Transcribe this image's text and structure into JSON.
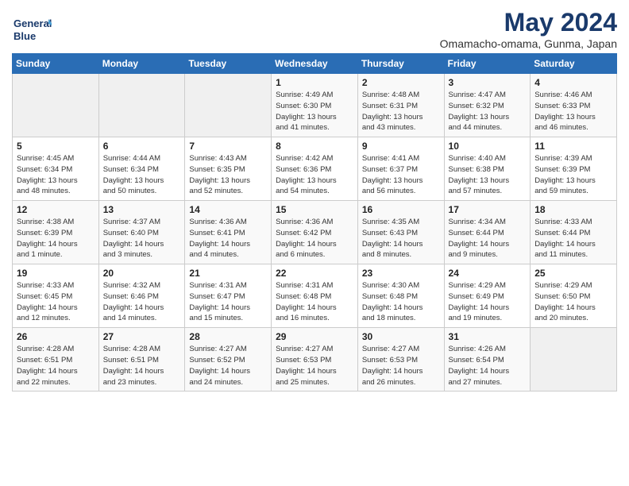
{
  "header": {
    "logo_line1": "General",
    "logo_line2": "Blue",
    "month_year": "May 2024",
    "location": "Omamacho-omama, Gunma, Japan"
  },
  "weekdays": [
    "Sunday",
    "Monday",
    "Tuesday",
    "Wednesday",
    "Thursday",
    "Friday",
    "Saturday"
  ],
  "weeks": [
    [
      {
        "day": "",
        "info": ""
      },
      {
        "day": "",
        "info": ""
      },
      {
        "day": "",
        "info": ""
      },
      {
        "day": "1",
        "info": "Sunrise: 4:49 AM\nSunset: 6:30 PM\nDaylight: 13 hours\nand 41 minutes."
      },
      {
        "day": "2",
        "info": "Sunrise: 4:48 AM\nSunset: 6:31 PM\nDaylight: 13 hours\nand 43 minutes."
      },
      {
        "day": "3",
        "info": "Sunrise: 4:47 AM\nSunset: 6:32 PM\nDaylight: 13 hours\nand 44 minutes."
      },
      {
        "day": "4",
        "info": "Sunrise: 4:46 AM\nSunset: 6:33 PM\nDaylight: 13 hours\nand 46 minutes."
      }
    ],
    [
      {
        "day": "5",
        "info": "Sunrise: 4:45 AM\nSunset: 6:34 PM\nDaylight: 13 hours\nand 48 minutes."
      },
      {
        "day": "6",
        "info": "Sunrise: 4:44 AM\nSunset: 6:34 PM\nDaylight: 13 hours\nand 50 minutes."
      },
      {
        "day": "7",
        "info": "Sunrise: 4:43 AM\nSunset: 6:35 PM\nDaylight: 13 hours\nand 52 minutes."
      },
      {
        "day": "8",
        "info": "Sunrise: 4:42 AM\nSunset: 6:36 PM\nDaylight: 13 hours\nand 54 minutes."
      },
      {
        "day": "9",
        "info": "Sunrise: 4:41 AM\nSunset: 6:37 PM\nDaylight: 13 hours\nand 56 minutes."
      },
      {
        "day": "10",
        "info": "Sunrise: 4:40 AM\nSunset: 6:38 PM\nDaylight: 13 hours\nand 57 minutes."
      },
      {
        "day": "11",
        "info": "Sunrise: 4:39 AM\nSunset: 6:39 PM\nDaylight: 13 hours\nand 59 minutes."
      }
    ],
    [
      {
        "day": "12",
        "info": "Sunrise: 4:38 AM\nSunset: 6:39 PM\nDaylight: 14 hours\nand 1 minute."
      },
      {
        "day": "13",
        "info": "Sunrise: 4:37 AM\nSunset: 6:40 PM\nDaylight: 14 hours\nand 3 minutes."
      },
      {
        "day": "14",
        "info": "Sunrise: 4:36 AM\nSunset: 6:41 PM\nDaylight: 14 hours\nand 4 minutes."
      },
      {
        "day": "15",
        "info": "Sunrise: 4:36 AM\nSunset: 6:42 PM\nDaylight: 14 hours\nand 6 minutes."
      },
      {
        "day": "16",
        "info": "Sunrise: 4:35 AM\nSunset: 6:43 PM\nDaylight: 14 hours\nand 8 minutes."
      },
      {
        "day": "17",
        "info": "Sunrise: 4:34 AM\nSunset: 6:44 PM\nDaylight: 14 hours\nand 9 minutes."
      },
      {
        "day": "18",
        "info": "Sunrise: 4:33 AM\nSunset: 6:44 PM\nDaylight: 14 hours\nand 11 minutes."
      }
    ],
    [
      {
        "day": "19",
        "info": "Sunrise: 4:33 AM\nSunset: 6:45 PM\nDaylight: 14 hours\nand 12 minutes."
      },
      {
        "day": "20",
        "info": "Sunrise: 4:32 AM\nSunset: 6:46 PM\nDaylight: 14 hours\nand 14 minutes."
      },
      {
        "day": "21",
        "info": "Sunrise: 4:31 AM\nSunset: 6:47 PM\nDaylight: 14 hours\nand 15 minutes."
      },
      {
        "day": "22",
        "info": "Sunrise: 4:31 AM\nSunset: 6:48 PM\nDaylight: 14 hours\nand 16 minutes."
      },
      {
        "day": "23",
        "info": "Sunrise: 4:30 AM\nSunset: 6:48 PM\nDaylight: 14 hours\nand 18 minutes."
      },
      {
        "day": "24",
        "info": "Sunrise: 4:29 AM\nSunset: 6:49 PM\nDaylight: 14 hours\nand 19 minutes."
      },
      {
        "day": "25",
        "info": "Sunrise: 4:29 AM\nSunset: 6:50 PM\nDaylight: 14 hours\nand 20 minutes."
      }
    ],
    [
      {
        "day": "26",
        "info": "Sunrise: 4:28 AM\nSunset: 6:51 PM\nDaylight: 14 hours\nand 22 minutes."
      },
      {
        "day": "27",
        "info": "Sunrise: 4:28 AM\nSunset: 6:51 PM\nDaylight: 14 hours\nand 23 minutes."
      },
      {
        "day": "28",
        "info": "Sunrise: 4:27 AM\nSunset: 6:52 PM\nDaylight: 14 hours\nand 24 minutes."
      },
      {
        "day": "29",
        "info": "Sunrise: 4:27 AM\nSunset: 6:53 PM\nDaylight: 14 hours\nand 25 minutes."
      },
      {
        "day": "30",
        "info": "Sunrise: 4:27 AM\nSunset: 6:53 PM\nDaylight: 14 hours\nand 26 minutes."
      },
      {
        "day": "31",
        "info": "Sunrise: 4:26 AM\nSunset: 6:54 PM\nDaylight: 14 hours\nand 27 minutes."
      },
      {
        "day": "",
        "info": ""
      }
    ]
  ]
}
